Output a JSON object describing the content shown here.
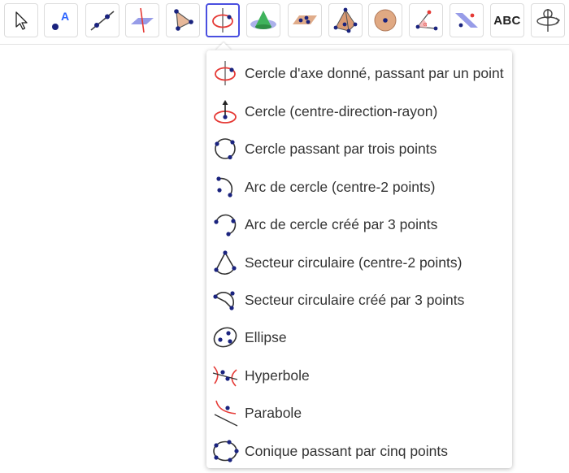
{
  "toolbar": {
    "tools": [
      {
        "icon": "move-arrow-icon"
      },
      {
        "icon": "point-icon"
      },
      {
        "icon": "line-icon"
      },
      {
        "icon": "perpendicular-plane-icon"
      },
      {
        "icon": "polygon-icon"
      },
      {
        "icon": "circle-axis-point-icon",
        "selected": true
      },
      {
        "icon": "cone-icon"
      },
      {
        "icon": "plane-points-icon"
      },
      {
        "icon": "pyramid-icon"
      },
      {
        "icon": "sphere-icon"
      },
      {
        "icon": "angle-icon"
      },
      {
        "icon": "reflect-plane-icon"
      },
      {
        "icon": "text-tool-icon",
        "label": "ABC"
      },
      {
        "icon": "rotate-view-icon"
      }
    ]
  },
  "menu": {
    "items": [
      {
        "label": "Cercle d'axe donné, passant par un point"
      },
      {
        "label": "Cercle (centre-direction-rayon)"
      },
      {
        "label": "Cercle passant par trois points"
      },
      {
        "label": "Arc de cercle (centre-2 points)"
      },
      {
        "label": "Arc de cercle créé par 3 points"
      },
      {
        "label": "Secteur circulaire (centre-2 points)"
      },
      {
        "label": "Secteur circulaire créé par 3 points"
      },
      {
        "label": "Ellipse"
      },
      {
        "label": "Hyperbole"
      },
      {
        "label": "Parabole"
      },
      {
        "label": "Conique passant par cinq points"
      }
    ]
  },
  "colors": {
    "selected_border": "#4a4fe0",
    "point": "#1a237e",
    "red": "#e53935",
    "text": "#333333"
  }
}
